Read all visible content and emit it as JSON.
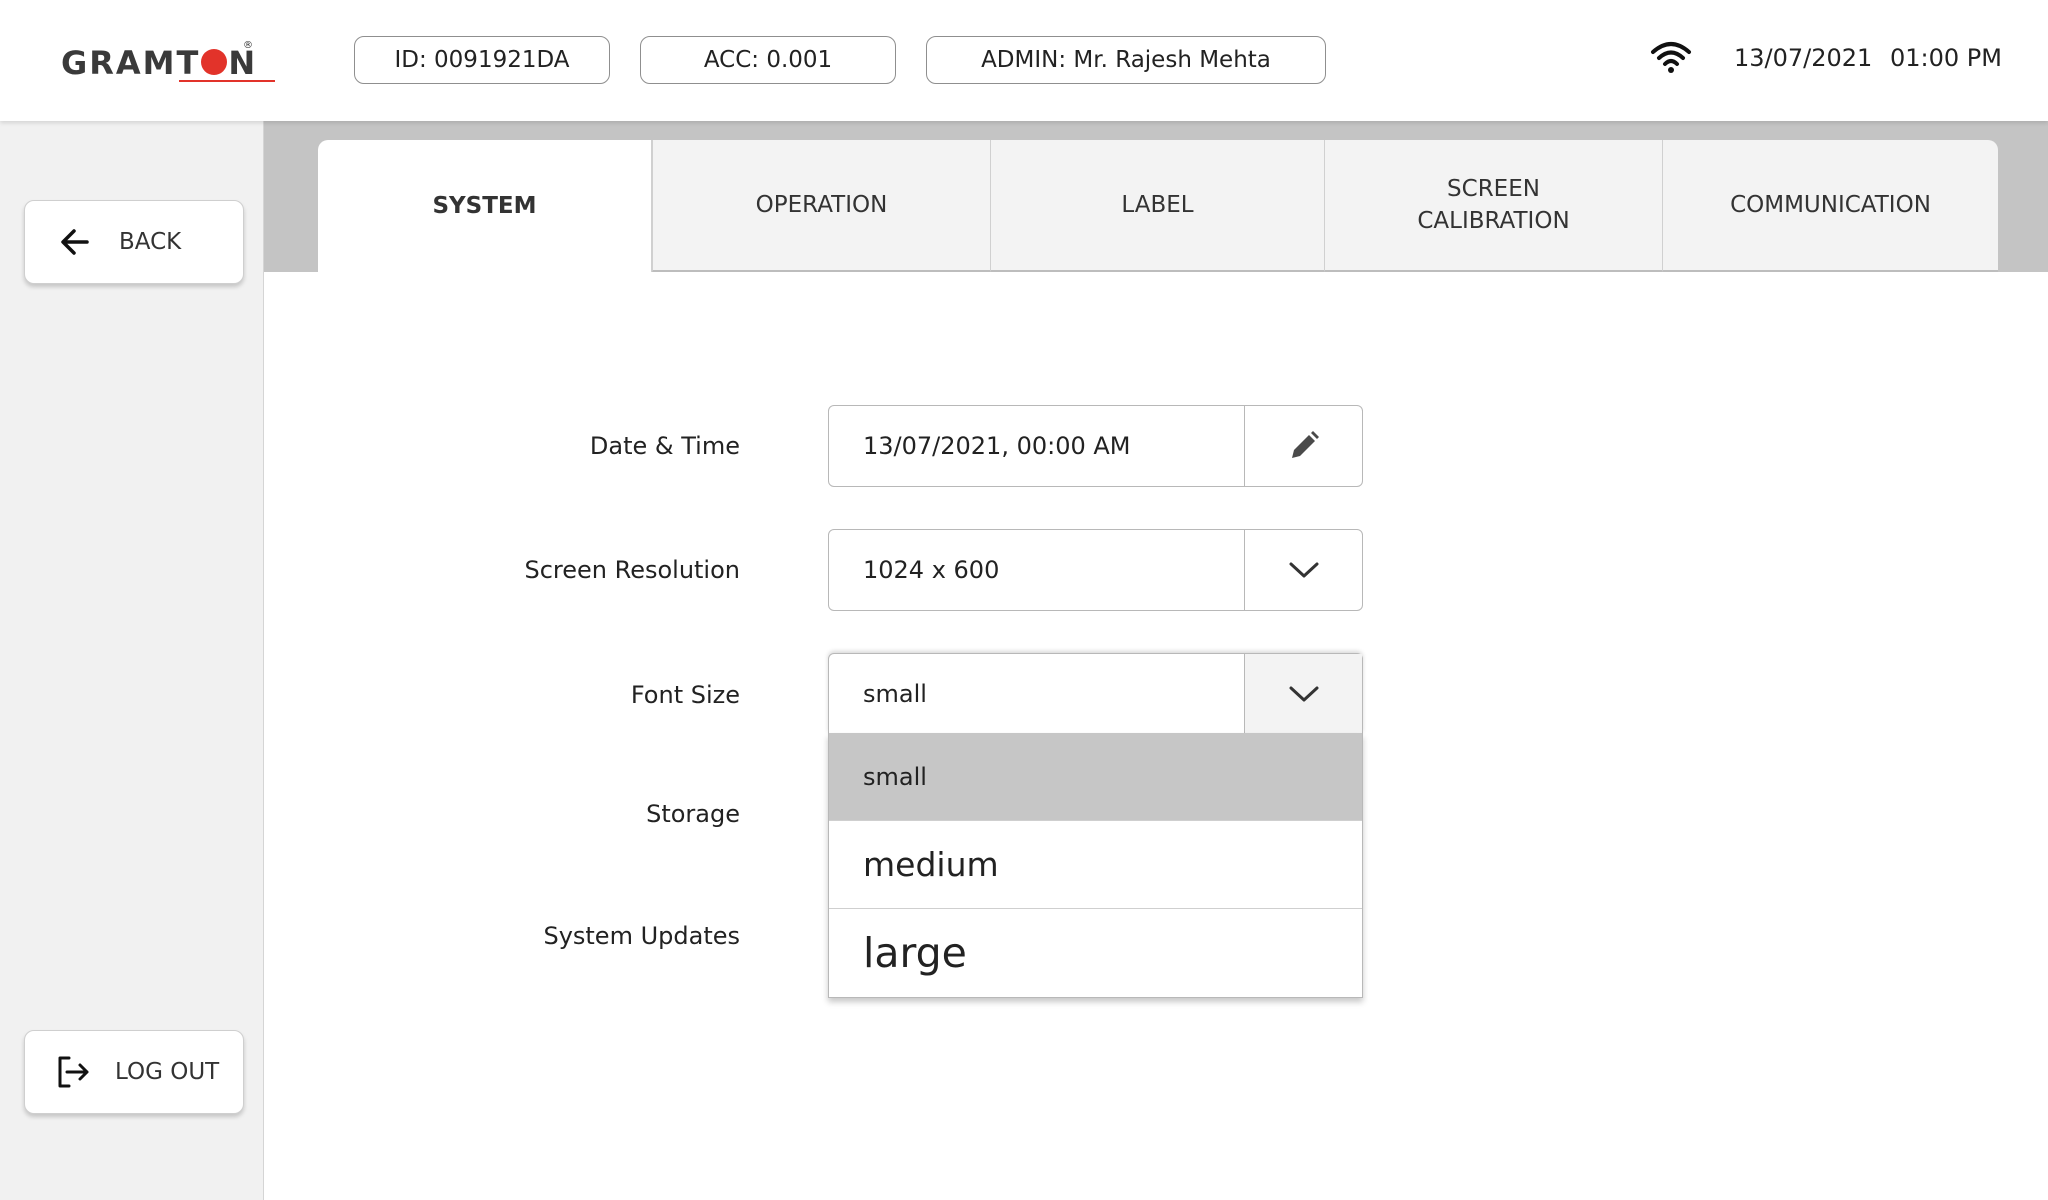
{
  "header": {
    "logo": {
      "text_before": "GRAMT",
      "text_after": "N",
      "registered": "®"
    },
    "device_id": "ID: 0091921DA",
    "accuracy": "ACC: 0.001",
    "admin": "ADMIN: Mr. Rajesh Mehta",
    "date": "13/07/2021",
    "time": "01:00 PM"
  },
  "sidebar": {
    "back_label": "BACK",
    "logout_label": "LOG OUT"
  },
  "tabs": [
    {
      "label": "SYSTEM",
      "active": true
    },
    {
      "label": "OPERATION",
      "active": false
    },
    {
      "label": "LABEL",
      "active": false
    },
    {
      "label": "SCREEN\nCALIBRATION",
      "active": false
    },
    {
      "label": "COMMUNICATION",
      "active": false
    }
  ],
  "form": {
    "date_time": {
      "label": "Date & Time",
      "value": "13/07/2021, 00:00 AM"
    },
    "screen_resolution": {
      "label": "Screen Resolution",
      "value": "1024 x 600"
    },
    "font_size": {
      "label": "Font Size",
      "value": "small",
      "options": [
        "small",
        "medium",
        "large"
      ]
    },
    "storage": {
      "label": "Storage"
    },
    "system_updates": {
      "label": "System Updates"
    }
  },
  "colors": {
    "logo_accent": "#e2332a",
    "tab_strip": "#c4c4c4",
    "selected_option": "#c6c6c6",
    "sidebar_bg": "#f1f1f1"
  },
  "icons": {
    "wifi": "wifi-icon",
    "back": "arrow-left-icon",
    "logout": "logout-icon",
    "edit": "pencil-icon",
    "dropdown": "chevron-down-icon"
  }
}
